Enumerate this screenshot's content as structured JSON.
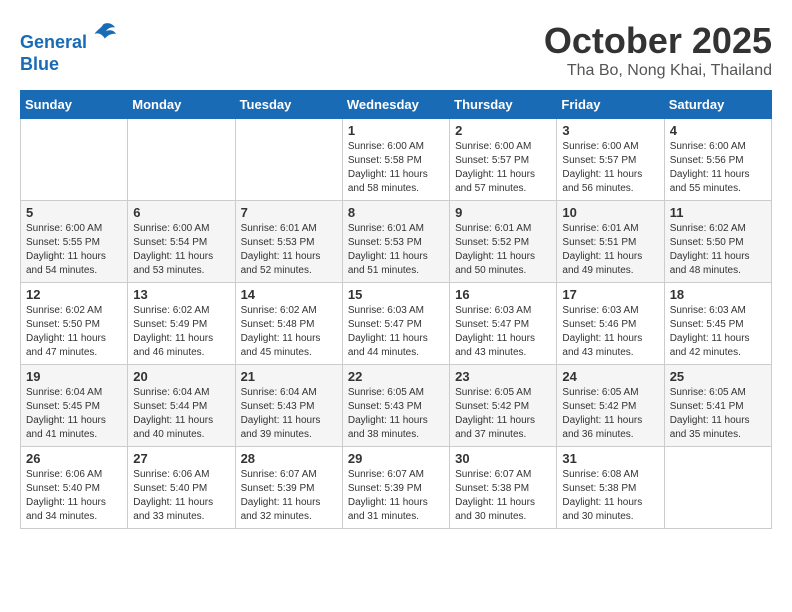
{
  "header": {
    "logo_line1": "General",
    "logo_line2": "Blue",
    "month_title": "October 2025",
    "subtitle": "Tha Bo, Nong Khai, Thailand"
  },
  "weekdays": [
    "Sunday",
    "Monday",
    "Tuesday",
    "Wednesday",
    "Thursday",
    "Friday",
    "Saturday"
  ],
  "weeks": [
    [
      {
        "day": "",
        "info": ""
      },
      {
        "day": "",
        "info": ""
      },
      {
        "day": "",
        "info": ""
      },
      {
        "day": "1",
        "info": "Sunrise: 6:00 AM\nSunset: 5:58 PM\nDaylight: 11 hours\nand 58 minutes."
      },
      {
        "day": "2",
        "info": "Sunrise: 6:00 AM\nSunset: 5:57 PM\nDaylight: 11 hours\nand 57 minutes."
      },
      {
        "day": "3",
        "info": "Sunrise: 6:00 AM\nSunset: 5:57 PM\nDaylight: 11 hours\nand 56 minutes."
      },
      {
        "day": "4",
        "info": "Sunrise: 6:00 AM\nSunset: 5:56 PM\nDaylight: 11 hours\nand 55 minutes."
      }
    ],
    [
      {
        "day": "5",
        "info": "Sunrise: 6:00 AM\nSunset: 5:55 PM\nDaylight: 11 hours\nand 54 minutes."
      },
      {
        "day": "6",
        "info": "Sunrise: 6:00 AM\nSunset: 5:54 PM\nDaylight: 11 hours\nand 53 minutes."
      },
      {
        "day": "7",
        "info": "Sunrise: 6:01 AM\nSunset: 5:53 PM\nDaylight: 11 hours\nand 52 minutes."
      },
      {
        "day": "8",
        "info": "Sunrise: 6:01 AM\nSunset: 5:53 PM\nDaylight: 11 hours\nand 51 minutes."
      },
      {
        "day": "9",
        "info": "Sunrise: 6:01 AM\nSunset: 5:52 PM\nDaylight: 11 hours\nand 50 minutes."
      },
      {
        "day": "10",
        "info": "Sunrise: 6:01 AM\nSunset: 5:51 PM\nDaylight: 11 hours\nand 49 minutes."
      },
      {
        "day": "11",
        "info": "Sunrise: 6:02 AM\nSunset: 5:50 PM\nDaylight: 11 hours\nand 48 minutes."
      }
    ],
    [
      {
        "day": "12",
        "info": "Sunrise: 6:02 AM\nSunset: 5:50 PM\nDaylight: 11 hours\nand 47 minutes."
      },
      {
        "day": "13",
        "info": "Sunrise: 6:02 AM\nSunset: 5:49 PM\nDaylight: 11 hours\nand 46 minutes."
      },
      {
        "day": "14",
        "info": "Sunrise: 6:02 AM\nSunset: 5:48 PM\nDaylight: 11 hours\nand 45 minutes."
      },
      {
        "day": "15",
        "info": "Sunrise: 6:03 AM\nSunset: 5:47 PM\nDaylight: 11 hours\nand 44 minutes."
      },
      {
        "day": "16",
        "info": "Sunrise: 6:03 AM\nSunset: 5:47 PM\nDaylight: 11 hours\nand 43 minutes."
      },
      {
        "day": "17",
        "info": "Sunrise: 6:03 AM\nSunset: 5:46 PM\nDaylight: 11 hours\nand 43 minutes."
      },
      {
        "day": "18",
        "info": "Sunrise: 6:03 AM\nSunset: 5:45 PM\nDaylight: 11 hours\nand 42 minutes."
      }
    ],
    [
      {
        "day": "19",
        "info": "Sunrise: 6:04 AM\nSunset: 5:45 PM\nDaylight: 11 hours\nand 41 minutes."
      },
      {
        "day": "20",
        "info": "Sunrise: 6:04 AM\nSunset: 5:44 PM\nDaylight: 11 hours\nand 40 minutes."
      },
      {
        "day": "21",
        "info": "Sunrise: 6:04 AM\nSunset: 5:43 PM\nDaylight: 11 hours\nand 39 minutes."
      },
      {
        "day": "22",
        "info": "Sunrise: 6:05 AM\nSunset: 5:43 PM\nDaylight: 11 hours\nand 38 minutes."
      },
      {
        "day": "23",
        "info": "Sunrise: 6:05 AM\nSunset: 5:42 PM\nDaylight: 11 hours\nand 37 minutes."
      },
      {
        "day": "24",
        "info": "Sunrise: 6:05 AM\nSunset: 5:42 PM\nDaylight: 11 hours\nand 36 minutes."
      },
      {
        "day": "25",
        "info": "Sunrise: 6:05 AM\nSunset: 5:41 PM\nDaylight: 11 hours\nand 35 minutes."
      }
    ],
    [
      {
        "day": "26",
        "info": "Sunrise: 6:06 AM\nSunset: 5:40 PM\nDaylight: 11 hours\nand 34 minutes."
      },
      {
        "day": "27",
        "info": "Sunrise: 6:06 AM\nSunset: 5:40 PM\nDaylight: 11 hours\nand 33 minutes."
      },
      {
        "day": "28",
        "info": "Sunrise: 6:07 AM\nSunset: 5:39 PM\nDaylight: 11 hours\nand 32 minutes."
      },
      {
        "day": "29",
        "info": "Sunrise: 6:07 AM\nSunset: 5:39 PM\nDaylight: 11 hours\nand 31 minutes."
      },
      {
        "day": "30",
        "info": "Sunrise: 6:07 AM\nSunset: 5:38 PM\nDaylight: 11 hours\nand 30 minutes."
      },
      {
        "day": "31",
        "info": "Sunrise: 6:08 AM\nSunset: 5:38 PM\nDaylight: 11 hours\nand 30 minutes."
      },
      {
        "day": "",
        "info": ""
      }
    ]
  ]
}
